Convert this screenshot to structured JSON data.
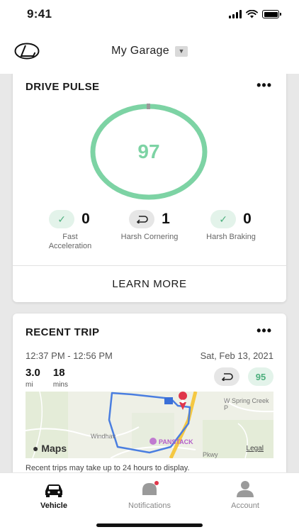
{
  "status_bar": {
    "time": "9:41"
  },
  "header": {
    "title": "My Garage",
    "dropdown_icon": "chevron-down-icon"
  },
  "drive_pulse": {
    "title": "DRIVE PULSE",
    "more_label": "•••",
    "score": "97",
    "score_color": "#7dd3a4",
    "metrics": [
      {
        "icon": "check-icon",
        "value": "0",
        "label": "Fast Acceleration"
      },
      {
        "icon": "u-turn-icon",
        "value": "1",
        "label": "Harsh Cornering"
      },
      {
        "icon": "check-icon",
        "value": "0",
        "label": "Harsh Braking"
      }
    ],
    "learn_more": "LEARN MORE"
  },
  "recent_trip": {
    "title": "RECENT TRIP",
    "more_label": "•••",
    "time_range": "12:37 PM - 12:56 PM",
    "date": "Sat, Feb 13, 2021",
    "distance_value": "3.0",
    "distance_unit": "mi",
    "duration_value": "18",
    "duration_unit": "mins",
    "trip_score": "95",
    "map": {
      "brand": "Maps",
      "legal": "Legal",
      "labels": {
        "spring_creek": "W Spring Creek P",
        "windhaven": "Windhav",
        "panstack": "PANSTACK",
        "parkway": "Pkwy"
      }
    },
    "note": "Recent trips may take up to 24 hours to display."
  },
  "tabs": [
    {
      "label": "Vehicle",
      "icon": "car-icon",
      "active": true
    },
    {
      "label": "Notifications",
      "icon": "bell-icon",
      "active": false
    },
    {
      "label": "Account",
      "icon": "person-icon",
      "active": false
    }
  ],
  "colors": {
    "accent_green": "#7dd3a4",
    "notification_dot": "#e0364a",
    "route_blue": "#4a7ee0"
  }
}
